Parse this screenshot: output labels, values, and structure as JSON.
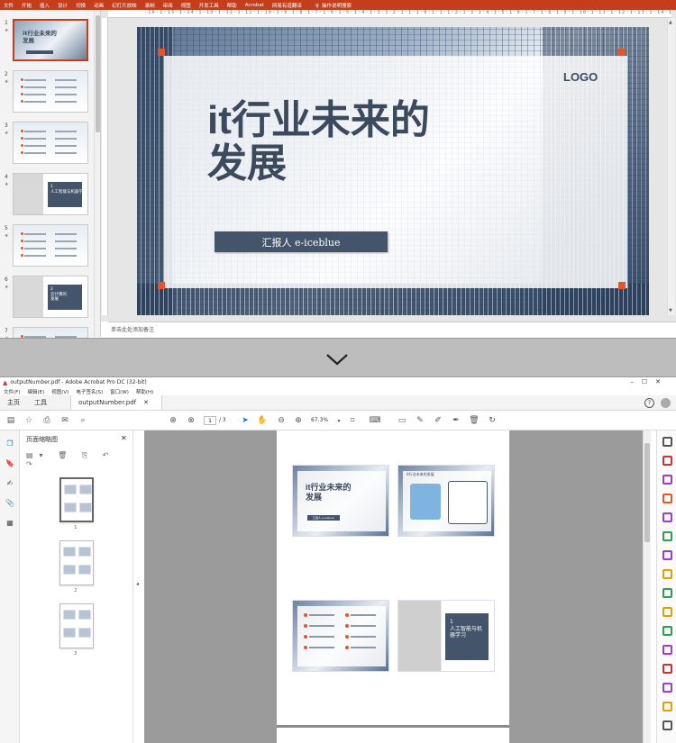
{
  "ppt": {
    "ribbon_tabs": [
      "文件",
      "开始",
      "插入",
      "设计",
      "切换",
      "动画",
      "幻灯片放映",
      "录制",
      "审阅",
      "视图",
      "开发工具",
      "帮助",
      "Acrobat",
      "网易有道翻译"
    ],
    "tell_me": "操作说明搜索",
    "thumb_numbers": [
      "1",
      "2",
      "3",
      "4",
      "5",
      "6",
      "7"
    ],
    "ruler_text": "·16·1·15·1·14·1·13·1·12·1·11·1·10·1·9·1·8·1·7·1·6·1·5·1·4·1·3·1·2·1·1·1·0·1·1·1·2·1·3·1·4·1·5·1·6·1·7·1·8·1·9·1·10·1·11·1·12·1·13·1·14·1·15·1·16",
    "slide": {
      "title_line1": "it行业未来的",
      "title_line2": "发展",
      "logo": "LOGO",
      "reporter": "汇报人 e-iceblue"
    },
    "notes_placeholder": "单击此处添加备注",
    "thumb4_text": "1\n人工智能与机器学习",
    "thumb6_text": "2\n云计算的\n发展"
  },
  "acrobat": {
    "window_title": "outputNumber.pdf - Adobe Acrobat Pro DC (32-bit)",
    "menu": [
      "文件(F)",
      "编辑(E)",
      "视图(V)",
      "电子签名(S)",
      "窗口(W)",
      "帮助(H)"
    ],
    "tabs": {
      "home": "主页",
      "tools": "工具",
      "doc": "outputNumber.pdf"
    },
    "page_current": "1",
    "page_total": "/ 3",
    "zoom": "67.3%",
    "panel_title": "页面缩略图",
    "thumb_labels": [
      "1",
      "2",
      "3"
    ],
    "page_slide1_title": "it行业未来的\n发展",
    "page_slide1_reporter": "汇报人 e-iceblue",
    "page_slide2_title": "it行业未来的发展",
    "page_slide4_text": "1\n人工智能与机\n器学习"
  },
  "colors": {
    "ppt_accent": "#c43e1c",
    "slate": "#44546a",
    "orange": "#e8542a",
    "acrobat_red": "#d32f2f"
  }
}
